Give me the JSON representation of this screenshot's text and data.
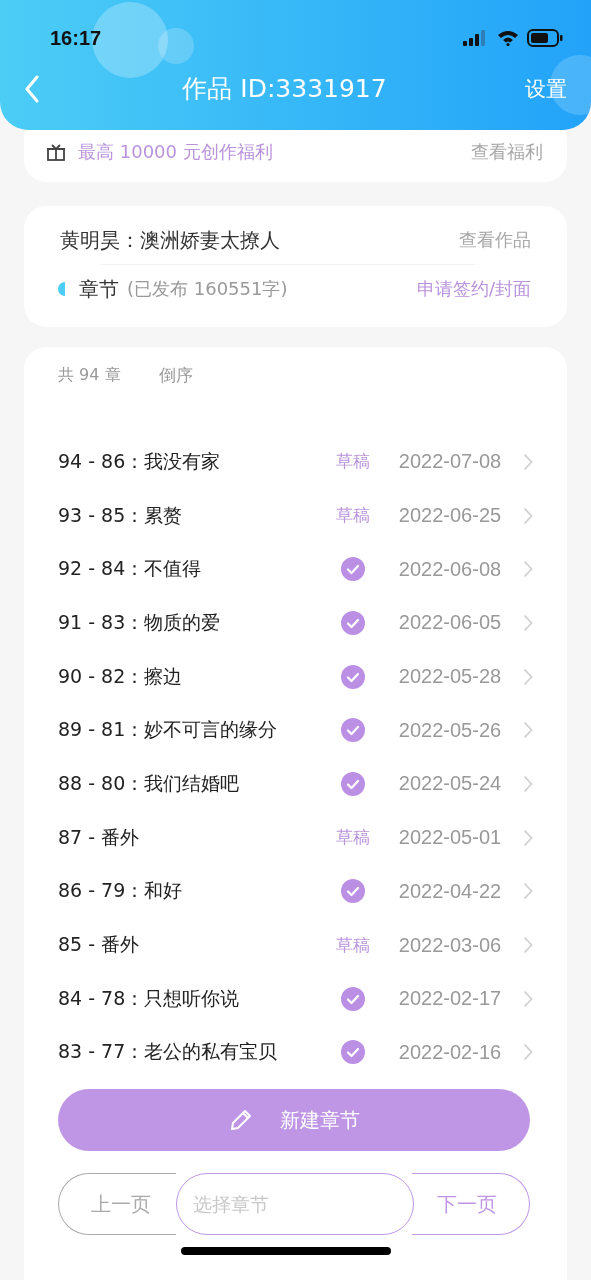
{
  "status_bar": {
    "time": "16:17"
  },
  "header": {
    "title": "作品 ID:3331917",
    "action": "设置"
  },
  "benefit": {
    "text": "最高 10000 元创作福利",
    "link": "查看福利"
  },
  "work": {
    "title": "黄明昊：澳洲娇妻太撩人",
    "link": "查看作品",
    "section": "章节",
    "stats": "(已发布 160551字)",
    "action": "申请签约/封面"
  },
  "chapter_list": {
    "count": "共 94 章",
    "sort": "倒序",
    "chapters": [
      {
        "title": "94 - 86：我没有家",
        "kind": "draft",
        "status": "草稿",
        "date": "2022-07-08"
      },
      {
        "title": "93 - 85：累赘",
        "kind": "draft",
        "status": "草稿",
        "date": "2022-06-25"
      },
      {
        "title": "92 - 84：不值得",
        "kind": "published",
        "date": "2022-06-08"
      },
      {
        "title": "91 - 83：物质的爱",
        "kind": "published",
        "date": "2022-06-05"
      },
      {
        "title": "90 - 82：擦边",
        "kind": "published",
        "date": "2022-05-28"
      },
      {
        "title": "89 - 81：妙不可言的缘分",
        "kind": "published",
        "date": "2022-05-26"
      },
      {
        "title": "88 - 80：我们结婚吧",
        "kind": "published",
        "date": "2022-05-24"
      },
      {
        "title": "87 - 番外",
        "kind": "draft",
        "status": "草稿",
        "date": "2022-05-01"
      },
      {
        "title": "86 - 79：和好",
        "kind": "published",
        "date": "2022-04-22"
      },
      {
        "title": "85 - 番外",
        "kind": "draft",
        "status": "草稿",
        "date": "2022-03-06"
      },
      {
        "title": "84 - 78：只想听你说",
        "kind": "published",
        "date": "2022-02-17"
      },
      {
        "title": "83 - 77：老公的私有宝贝",
        "kind": "published",
        "date": "2022-02-16"
      }
    ]
  },
  "new_chapter_button": "新建章节",
  "pagination": {
    "prev": {
      "label": "上一页",
      "disabled": true
    },
    "select": {
      "placeholder": "选择章节"
    },
    "next": {
      "label": "下一页",
      "disabled": false
    }
  }
}
